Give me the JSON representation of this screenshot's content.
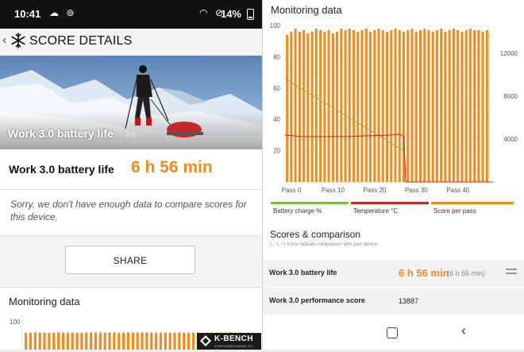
{
  "status_bar": {
    "time": "10:41",
    "battery_percent": "14%"
  },
  "app_bar": {
    "title": "SCORE DETAILS"
  },
  "hero": {
    "label": "Work 3.0 battery life",
    "version": "3.0"
  },
  "result": {
    "label": "Work 3.0 battery life",
    "value": "6 h 56 min"
  },
  "notice": {
    "text": "Sorry, we don't have enough data to compare scores for this device."
  },
  "share": {
    "label": "SHARE"
  },
  "monitoring_left": {
    "title": "Monitoring data"
  },
  "monitoring_right": {
    "title": "Monitoring data"
  },
  "legend": {
    "battery": "Battery charge %",
    "temperature": "Temperature °C",
    "score": "Score per pass"
  },
  "scores": {
    "title": "Scores & comparison",
    "subtitle": "(-, +, +) Icons indicate comparison with your device.",
    "rows": [
      {
        "label": "Work 3.0 battery life",
        "value": "6 h 56 min",
        "secondary": "(6 h 56 min)"
      },
      {
        "label": "Work 3.0 performance score",
        "value": "13887"
      }
    ]
  },
  "watermark": {
    "brand": "K-BENCH",
    "sub": "KOREA BENCHMARK CO., LTD."
  },
  "colors": {
    "accent": "#f08c1e",
    "battery": "#7ac142",
    "temperature": "#c62828",
    "score": "#f08c1e"
  },
  "chart_data": {
    "type": "bar",
    "x_tick_labels": [
      "Pass 0",
      "Pass 10",
      "Pass 20",
      "Pass 30",
      "Pass 40"
    ],
    "left_ticks": [
      "20",
      "40",
      "60",
      "80",
      "100"
    ],
    "right_ticks": [
      "4000",
      "8000",
      "12000"
    ],
    "left_ylim": [
      0,
      100
    ],
    "right_ylim": [
      0,
      14600
    ],
    "score_per_pass": [
      94,
      96,
      98,
      96,
      97,
      95,
      96,
      98,
      97,
      96,
      97,
      95,
      96,
      98,
      97,
      98,
      97,
      96,
      97,
      98,
      96,
      97,
      98,
      97,
      96,
      97,
      98,
      97,
      96,
      97,
      98,
      96,
      97,
      98,
      97,
      96,
      97,
      98,
      96,
      97,
      98,
      97,
      96,
      97,
      98,
      97,
      97,
      96,
      97
    ],
    "battery_charge": {
      "x": [
        0,
        28.5
      ],
      "y": [
        66,
        20
      ]
    },
    "temperature": {
      "x": [
        0,
        2,
        4,
        6,
        10,
        15,
        20,
        25,
        27,
        28,
        28.5,
        29,
        50
      ],
      "y": [
        30,
        29.5,
        29,
        29,
        29,
        29,
        29.5,
        30,
        30.5,
        30,
        29,
        0,
        0
      ]
    },
    "grid": true
  }
}
